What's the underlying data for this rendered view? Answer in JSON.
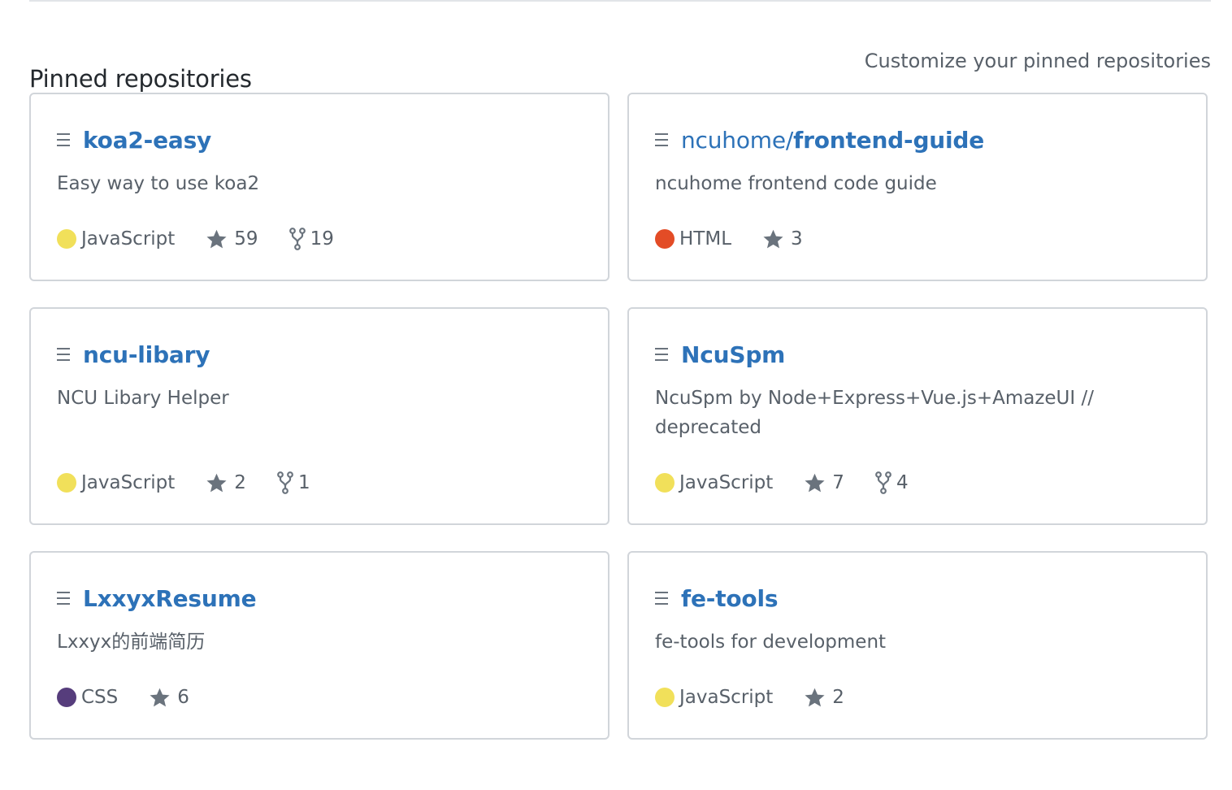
{
  "section": {
    "title": "Pinned repositories",
    "customize_label": "Customize your pinned repositories"
  },
  "icons": {
    "repo": "repo-icon",
    "star": "star-icon",
    "fork": "fork-icon"
  },
  "repos": [
    {
      "owner": "",
      "name": "koa2-easy",
      "description": "Easy way to use koa2",
      "language": "JavaScript",
      "language_color": "#f1e05a",
      "stars": "59",
      "forks": "19"
    },
    {
      "owner": "ncuhome/",
      "name": "frontend-guide",
      "description": "ncuhome frontend code guide",
      "language": "HTML",
      "language_color": "#e34c26",
      "stars": "3",
      "forks": ""
    },
    {
      "owner": "",
      "name": "ncu-libary",
      "description": "NCU Libary Helper",
      "language": "JavaScript",
      "language_color": "#f1e05a",
      "stars": "2",
      "forks": "1"
    },
    {
      "owner": "",
      "name": "NcuSpm",
      "description": "NcuSpm by Node+Express+Vue.js+AmazeUI // deprecated",
      "language": "JavaScript",
      "language_color": "#f1e05a",
      "stars": "7",
      "forks": "4"
    },
    {
      "owner": "",
      "name": "LxxyxResume",
      "description": "Lxxyx的前端简历",
      "language": "CSS",
      "language_color": "#563d7c",
      "stars": "6",
      "forks": ""
    },
    {
      "owner": "",
      "name": "fe-tools",
      "description": "fe-tools for development",
      "language": "JavaScript",
      "language_color": "#f1e05a",
      "stars": "2",
      "forks": ""
    }
  ]
}
